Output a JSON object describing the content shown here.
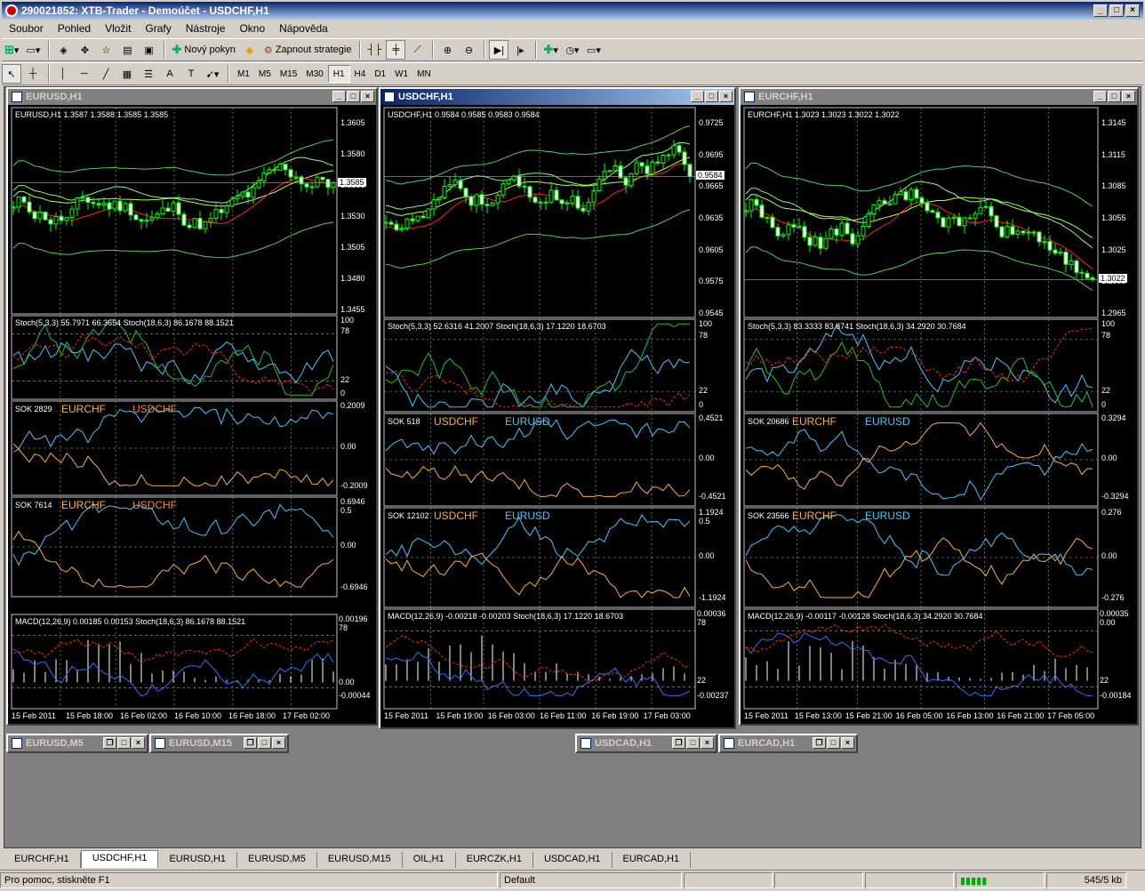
{
  "app": {
    "title": "290021852: XTB-Trader - Demoúčet - USDCHF,H1"
  },
  "menu": [
    "Soubor",
    "Pohled",
    "Vložit",
    "Grafy",
    "Nástroje",
    "Okno",
    "Nápověda"
  ],
  "toolbar": {
    "new_order": "Nový pokyn",
    "strategy": "Zapnout strategie"
  },
  "timeframes": [
    "M1",
    "M5",
    "M15",
    "M30",
    "H1",
    "H4",
    "D1",
    "W1",
    "MN"
  ],
  "active_timeframe": "H1",
  "windows": [
    {
      "title": "EURUSD,H1",
      "header": "EURUSD,H1  1.3587 1.3588 1.3585 1.3585",
      "price_ticks": [
        "1.3605",
        "1.3580",
        "1.3555",
        "1.3530",
        "1.3505",
        "1.3480",
        "1.3455"
      ],
      "current": "1.3585",
      "stoch": "Stoch(5,3,3) 55.7971 66.3654  Stoch(18,6,3) 86.1678 88.1521",
      "stoch_ticks": [
        "100",
        "78",
        "22",
        "0"
      ],
      "sok1": {
        "id": "SOK 2829",
        "a": "EURCHF",
        "b": "USDCHF",
        "ticks": [
          "0.2009",
          "0.00",
          "-0.2009"
        ]
      },
      "sok2": {
        "id": "SOK 7614",
        "a": "EURCHF",
        "b": "USDCHF",
        "ticks": [
          "0.6946",
          "0.5",
          "0.00",
          "-0.6946"
        ]
      },
      "macd": "MACD(12,26,9) 0.00185 0.00153  Stoch(18,6,3) 86.1678 88.1521",
      "macd_ticks": [
        "0.00196",
        "78",
        "0.00",
        "-0.00044"
      ],
      "dates": [
        "15 Feb 2011",
        "15 Feb 18:00",
        "16 Feb 02:00",
        "16 Feb 10:00",
        "16 Feb 18:00",
        "17 Feb 02:00"
      ]
    },
    {
      "title": "USDCHF,H1",
      "header": "USDCHF,H1  0.9584 0.9585 0.9583 0.9584",
      "price_ticks": [
        "0.9725",
        "0.9695",
        "0.9665",
        "0.9635",
        "0.9605",
        "0.9575",
        "0.9545"
      ],
      "current": "0.9584",
      "stoch": "Stoch(5,3,3) 52.6316 41.2007  Stoch(18,6,3) 17.1220 18.6703",
      "stoch_ticks": [
        "100",
        "78",
        "22",
        "0"
      ],
      "sok1": {
        "id": "SOK 518",
        "a": "USDCHF",
        "b": "EURUSD",
        "ticks": [
          "0.4521",
          "0.00",
          "-0.4521"
        ]
      },
      "sok2": {
        "id": "SOK 12102",
        "a": "USDCHF",
        "b": "EURUSD",
        "ticks": [
          "1.1924",
          "0.5",
          "0.00",
          "-1.1924"
        ]
      },
      "macd": "MACD(12,26,9) -0.00218 -0.00203  Stoch(18,6,3) 17.1220 18.6703",
      "macd_ticks": [
        "0.00036",
        "78",
        "22",
        "-0.00237"
      ],
      "dates": [
        "15 Feb 2011",
        "15 Feb 19:00",
        "16 Feb 03:00",
        "16 Feb 11:00",
        "16 Feb 19:00",
        "17 Feb 03:00"
      ]
    },
    {
      "title": "EURCHF,H1",
      "header": "EURCHF,H1  1.3023 1.3023 1.3022 1.3022",
      "price_ticks": [
        "1.3145",
        "1.3115",
        "1.3085",
        "1.3055",
        "1.3025",
        "1.2995",
        "1.2965"
      ],
      "current": "1.3022",
      "stoch": "Stoch(5,3,3) 83.3333 83.8741  Stoch(18,6,3) 34.2920 30.7684",
      "stoch_ticks": [
        "100",
        "78",
        "22",
        "0"
      ],
      "sok1": {
        "id": "SOK 20686",
        "a": "EURCHF",
        "b": "EURUSD",
        "ticks": [
          "0.3294",
          "0.00",
          "-0.3294"
        ]
      },
      "sok2": {
        "id": "SOK 23566",
        "a": "EURCHF",
        "b": "EURUSD",
        "ticks": [
          "0.276",
          "0.00",
          "-0.276"
        ]
      },
      "macd": "MACD(12,26,9) -0.00117 -0.00128  Stoch(18,6,3) 34.2920 30.7684",
      "macd_ticks": [
        "0.00035",
        "0.00",
        "22",
        "-0.00184"
      ],
      "dates": [
        "15 Feb 2011",
        "15 Feb 13:00",
        "15 Feb 21:00",
        "16 Feb 05:00",
        "16 Feb 13:00",
        "16 Feb 21:00",
        "17 Feb 05:00"
      ]
    }
  ],
  "minimized": [
    "EURUSD,M5",
    "EURUSD,M15",
    "USDCAD,H1",
    "EURCAD,H1"
  ],
  "tabs": [
    "EURCHF,H1",
    "USDCHF,H1",
    "EURUSD,H1",
    "EURUSD,M5",
    "EURUSD,M15",
    "OIL,H1",
    "EURCZK,H1",
    "USDCAD,H1",
    "EURCAD,H1"
  ],
  "active_tab": "USDCHF,H1",
  "status": {
    "help": "Pro pomoc, stiskněte F1",
    "profile": "Default",
    "traffic": "545/5 kb"
  },
  "colors": {
    "candle": "#00ff00",
    "ma_red": "#ff0000",
    "ma_green": "#7fff00",
    "sok_a": "#ffb030",
    "sok_b": "#40c8ff",
    "macd_hist": "#ffffff"
  }
}
